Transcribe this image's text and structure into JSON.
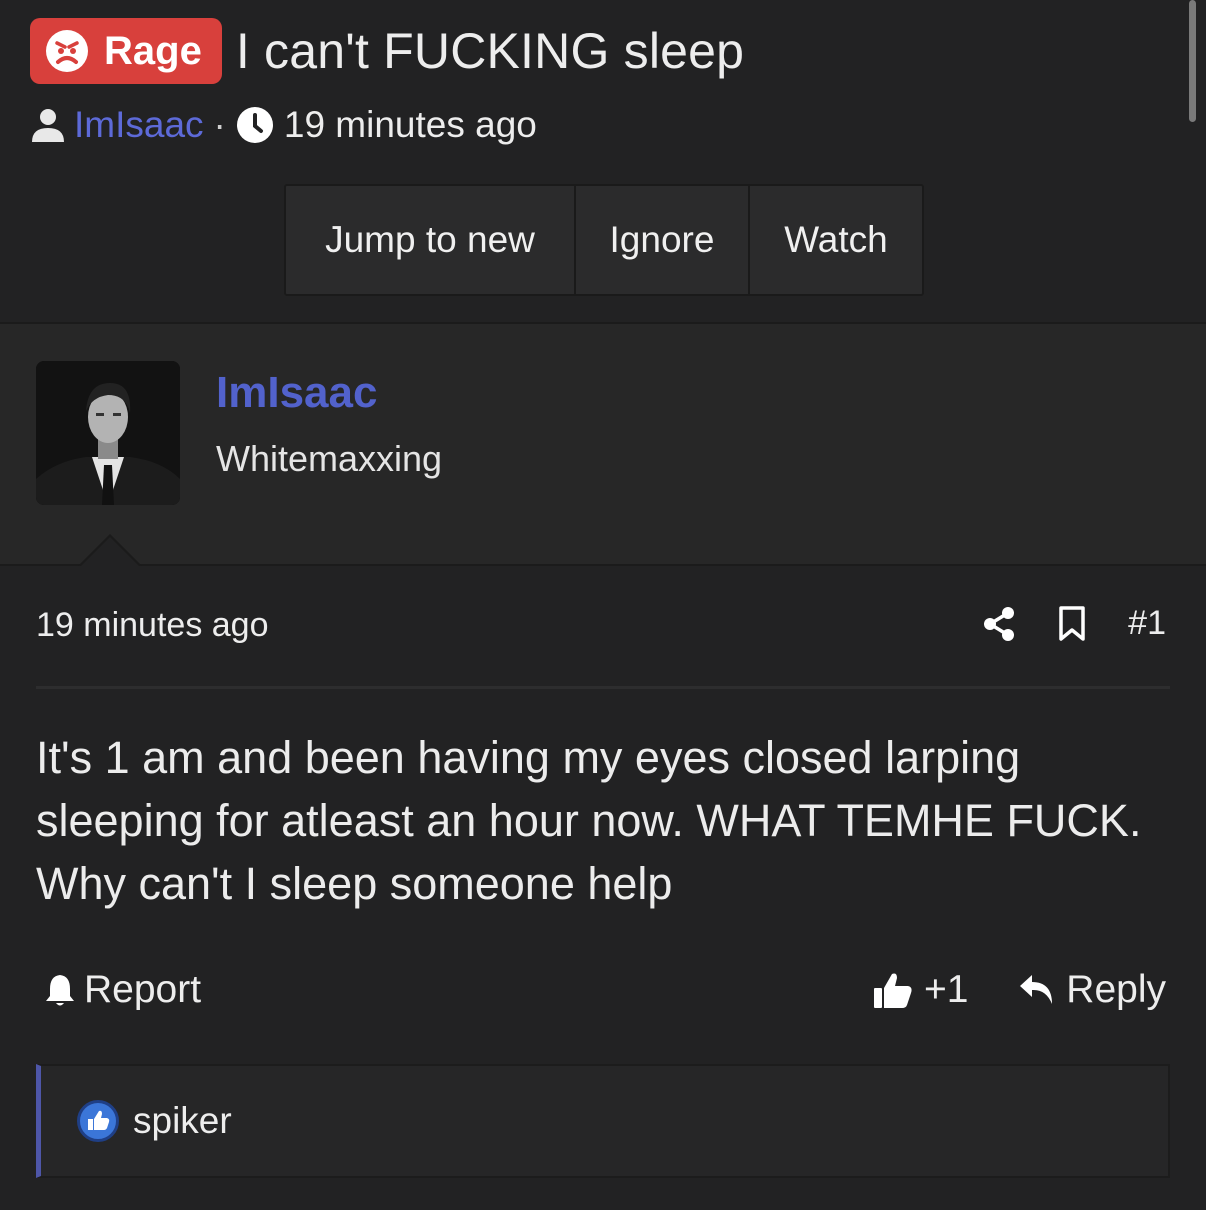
{
  "thread": {
    "prefix": "Rage",
    "prefix_color": "#d8403c",
    "title": "I can't FUCKING sleep",
    "author": "ImIsaac",
    "time": "19 minutes ago"
  },
  "thread_actions": {
    "jump": "Jump to new",
    "ignore": "Ignore",
    "watch": "Watch"
  },
  "post": {
    "author": "ImIsaac",
    "author_color": "#5262cc",
    "user_title": "Whitemaxxing",
    "date": "19 minutes ago",
    "number": "#1",
    "body": "It's 1 am and been having my eyes closed larping sleeping for atleast an hour now. WHAT TEMHE FUCK. Why can't I sleep someone help",
    "report": "Report",
    "reaction_count": "+1",
    "reply": "Reply",
    "reactions": {
      "user": "spiker",
      "icon": "like-icon"
    }
  }
}
